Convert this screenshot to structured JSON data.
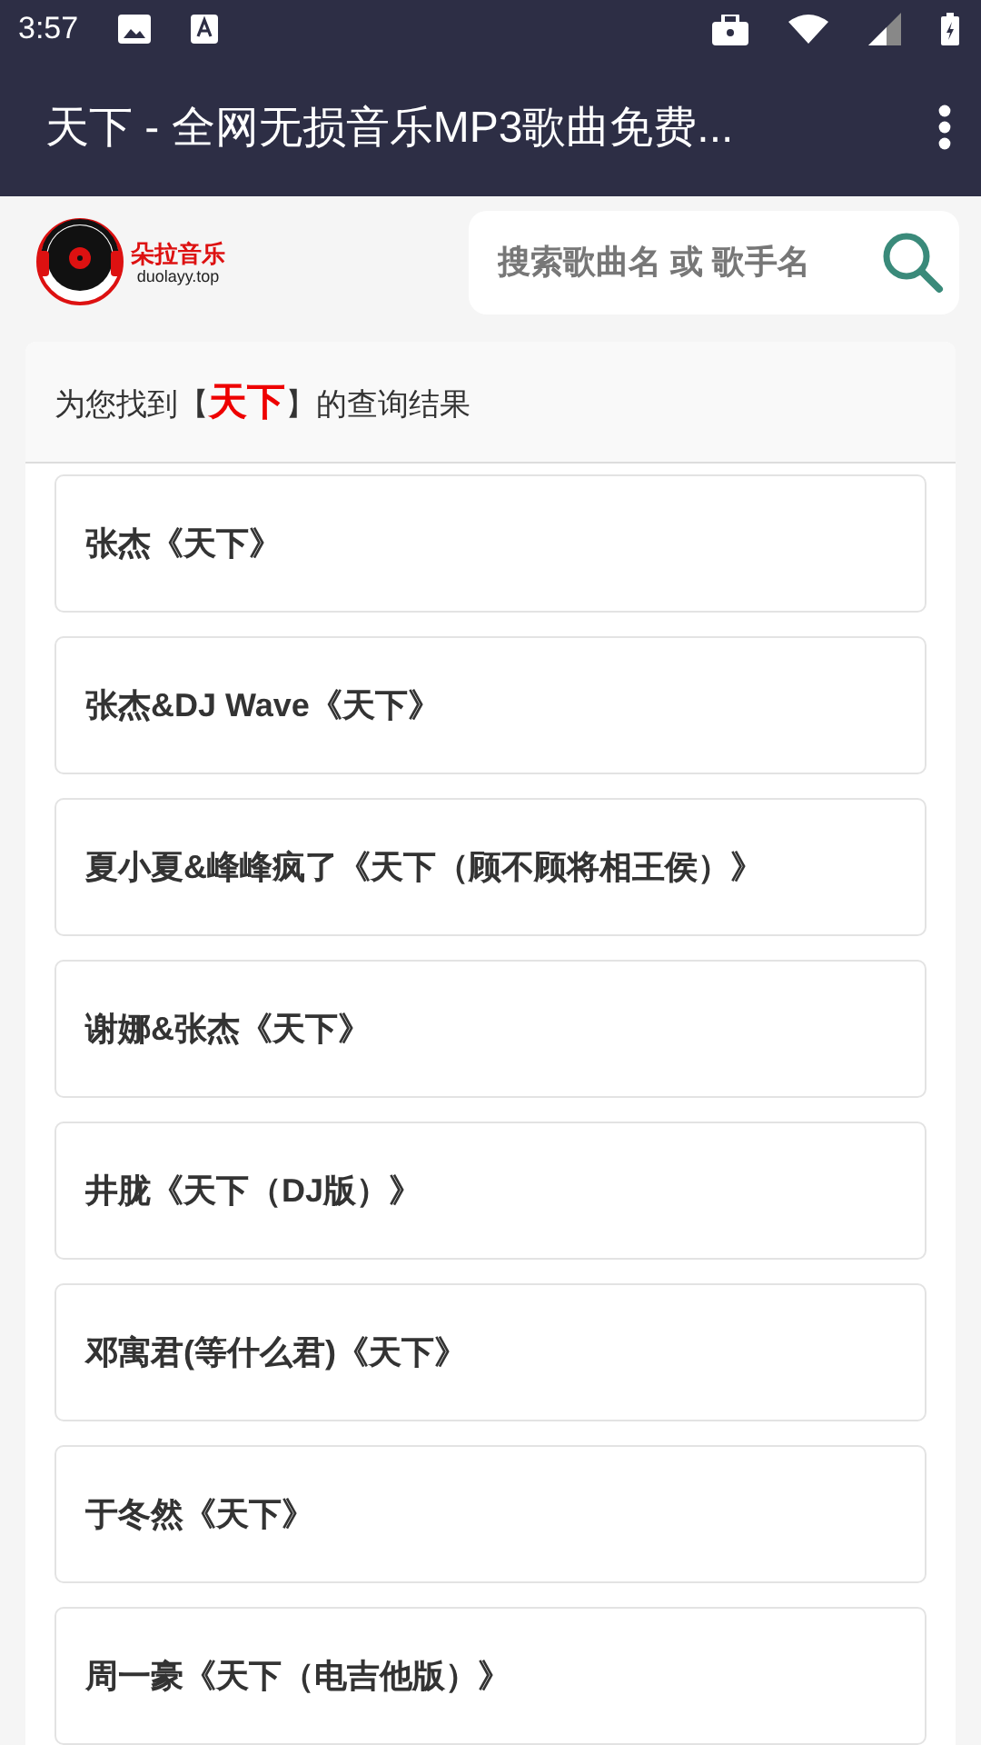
{
  "status_bar": {
    "time": "3:57"
  },
  "app_bar": {
    "title": "天下 - 全网无损音乐MP3歌曲免费..."
  },
  "logo": {
    "name": "朵拉音乐",
    "domain": "duolayy.top"
  },
  "search": {
    "placeholder": "搜索歌曲名 或 歌手名"
  },
  "results": {
    "heading": "为您找到【**天下**】的查询结果",
    "items": [
      {
        "title": "张杰《天下》"
      },
      {
        "title": "张杰&DJ Wave《天下》"
      },
      {
        "title": "夏小夏&峰峰疯了《天下（顾不顾将相王侯）》"
      },
      {
        "title": "谢娜&张杰《天下》"
      },
      {
        "title": "井胧《天下（DJ版）》"
      },
      {
        "title": "邓寓君(等什么君)《天下》"
      },
      {
        "title": "于冬然《天下》"
      },
      {
        "title": "周一豪《天下（电吉他版）》"
      }
    ]
  }
}
